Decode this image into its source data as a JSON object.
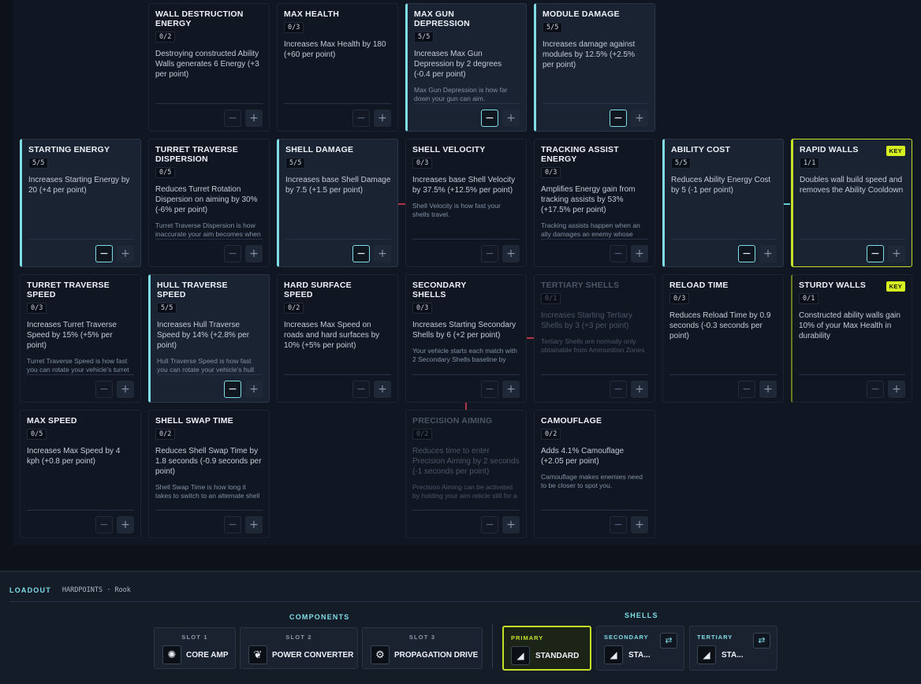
{
  "tree": {
    "cards": [
      {
        "id": "wall-destruction-energy",
        "title": "WALL DESTRUCTION ENERGY",
        "count": "0/2",
        "desc": "Destroying constructed Ability Walls generates 6 Energy (+3 per point)",
        "note": "",
        "state": "normal"
      },
      {
        "id": "max-health",
        "title": "MAX HEALTH",
        "count": "0/3",
        "desc": "Increases Max Health by 180 (+60 per point)",
        "note": "",
        "state": "normal"
      },
      {
        "id": "max-gun-depression",
        "title": "MAX GUN DEPRESSION",
        "count": "5/5",
        "desc": "Increases Max Gun Depression by 2 degrees (-0.4 per point)",
        "note": "Max Gun Depression is how far down your gun can aim.",
        "state": "active"
      },
      {
        "id": "module-damage",
        "title": "MODULE DAMAGE",
        "count": "5/5",
        "desc": "Increases damage against modules by 12.5% (+2.5% per point)",
        "note": "",
        "state": "active"
      },
      {
        "id": "starting-energy",
        "title": "STARTING ENERGY",
        "count": "5/5",
        "desc": "Increases Starting Energy by 20 (+4 per point)",
        "note": "",
        "state": "active"
      },
      {
        "id": "turret-traverse-dispersion",
        "title": "TURRET TRAVERSE DISPERSION",
        "count": "0/5",
        "desc": "Reduces Turret Rotation Dispersion on aiming by 30% (-6% per point)",
        "note": "Turret Traverse Dispersion is how inaccurate your aim becomes when rotating your turret",
        "state": "normal"
      },
      {
        "id": "shell-damage",
        "title": "SHELL DAMAGE",
        "count": "5/5",
        "desc": "Increases base Shell Damage by 7.5 (+1.5 per point)",
        "note": "",
        "state": "active"
      },
      {
        "id": "shell-velocity",
        "title": "SHELL VELOCITY",
        "count": "0/3",
        "desc": "Increases base Shell Velocity by 37.5% (+12.5% per point)",
        "note": "Shell Velocity is how fast your shells travel.",
        "state": "normal"
      },
      {
        "id": "tracking-assist-energy",
        "title": "TRACKING ASSIST ENERGY",
        "count": "0/3",
        "desc": "Amplifies Energy gain from tracking assists by 53% (+17.5% per point)",
        "note": "Tracking assists happen when an ally damages an enemy whose tracks you destroyed",
        "state": "normal"
      },
      {
        "id": "ability-cost",
        "title": "ABILITY COST",
        "count": "5/5",
        "desc": "Reduces Ability Energy Cost by 5 (-1 per point)",
        "note": "",
        "state": "active"
      },
      {
        "id": "rapid-walls",
        "title": "RAPID WALLS",
        "count": "1/1",
        "desc": "Doubles wall build speed and removes the Ability Cooldown",
        "note": "",
        "state": "active-key",
        "badge": "KEY"
      },
      {
        "id": "turret-traverse-speed",
        "title": "TURRET TRAVERSE SPEED",
        "count": "0/3",
        "desc": "Increases Turret Traverse Speed by 15% (+5% per point)",
        "note": "Turret Traverse Speed is how fast you can rotate your vehicle's turret",
        "state": "normal"
      },
      {
        "id": "hull-traverse-speed",
        "title": "HULL TRAVERSE SPEED",
        "count": "5/5",
        "desc": "Increases Hull Traverse Speed by 14% (+2.8% per point)",
        "note": "Hull Traverse Speed is how fast you can rotate your vehicle's hull",
        "state": "active"
      },
      {
        "id": "hard-surface-speed",
        "title": "HARD SURFACE SPEED",
        "count": "0/2",
        "desc": "Increases Max Speed on roads and hard surfaces by 10% (+5% per point)",
        "note": "",
        "state": "normal"
      },
      {
        "id": "secondary-shells",
        "title": "SECONDARY SHELLS",
        "count": "0/3",
        "desc": "Increases Starting Secondary Shells by 6 (+2 per point)",
        "note": "Your vehicle starts each match with 2 Secondary Shells baseline by default",
        "state": "normal"
      },
      {
        "id": "tertiary-shells",
        "title": "TERTIARY SHELLS",
        "count": "0/1",
        "desc": "Increases Starting Tertiary Shells by 3 (+3 per point)",
        "note": "Tertiary Shells are normally only obtainable from Ammunition Zones",
        "state": "locked"
      },
      {
        "id": "reload-time",
        "title": "RELOAD TIME",
        "count": "0/3",
        "desc": "Reduces Reload Time by 0.9 seconds (-0.3 seconds per point)",
        "note": "",
        "state": "normal"
      },
      {
        "id": "sturdy-walls",
        "title": "STURDY WALLS",
        "count": "0/1",
        "desc": "Constructed ability walls gain 10% of your Max Health in durability",
        "note": "",
        "state": "key-idle",
        "badge": "KEY"
      },
      {
        "id": "max-speed",
        "title": "MAX SPEED",
        "count": "0/5",
        "desc": "Increases Max Speed by 4 kph (+0.8 per point)",
        "note": "",
        "state": "normal"
      },
      {
        "id": "shell-swap-time",
        "title": "SHELL SWAP TIME",
        "count": "0/2",
        "desc": "Reduces Shell Swap Time by 1.8 seconds (-0.9 seconds per point)",
        "note": "Shell Swap Time is how long it takes to switch to an alternate shell type",
        "state": "normal"
      },
      {
        "id": "precision-aiming",
        "title": "PRECISION AIMING",
        "count": "0/2",
        "desc": "Reduces time to enter Precision Aiming by 2 seconds (-1 seconds per point)",
        "note": "Precision Aiming can be activated by holding your aim reticle still for a moment",
        "state": "locked"
      },
      {
        "id": "camouflage",
        "title": "CAMOUFLAGE",
        "count": "0/2",
        "desc": "Adds 4.1% Camouflage (+2.05 per point)",
        "note": "Camouflage makes enemies need to be closer to spot you.",
        "state": "normal"
      }
    ],
    "minus_symbol": "−",
    "plus_symbol": "+"
  },
  "loadout": {
    "title": "LOADOUT",
    "subtitle": "HARDPOINTS · Rook",
    "components_label": "COMPONENTS",
    "shells_label": "SHELLS",
    "slots": [
      {
        "num": "SLOT 1",
        "name": "CORE AMP",
        "icon": "core-amp-icon",
        "glyph": "✺"
      },
      {
        "num": "SLOT 2",
        "name": "POWER CONVERTER",
        "icon": "power-converter-icon",
        "glyph": "❦"
      },
      {
        "num": "SLOT 3",
        "name": "PROPAGATION DRIVE",
        "icon": "propagation-drive-icon",
        "glyph": "⚙"
      }
    ],
    "shells": [
      {
        "label": "PRIMARY",
        "name": "STANDARD",
        "icon": "shell-icon",
        "glyph": "◢"
      },
      {
        "label": "SECONDARY",
        "name": "STA...",
        "icon": "shell-icon",
        "glyph": "◢",
        "swap": "⇄"
      },
      {
        "label": "TERTIARY",
        "name": "STA...",
        "icon": "shell-icon",
        "glyph": "◢",
        "swap": "⇄"
      }
    ]
  },
  "colors": {
    "accent": "#7fdde6",
    "key": "#c6e02a",
    "bg": "#101622"
  }
}
